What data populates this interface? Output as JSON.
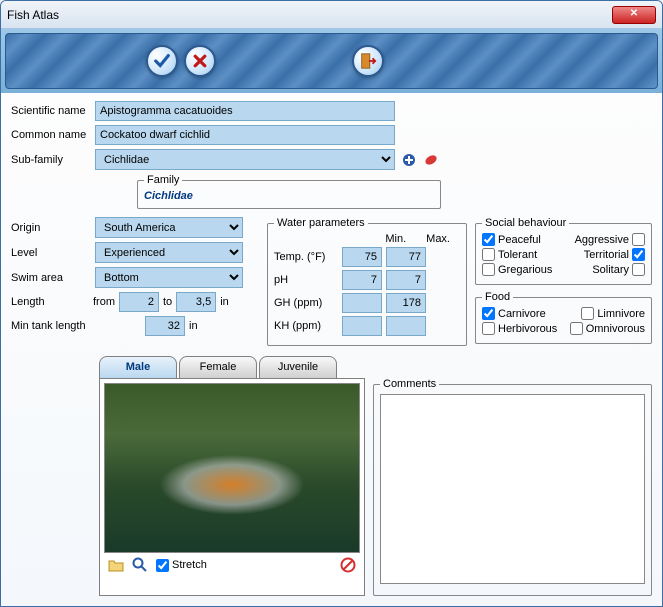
{
  "window": {
    "title": "Fish Atlas"
  },
  "labels": {
    "scientific_name": "Scientific name",
    "common_name": "Common name",
    "sub_family": "Sub-family",
    "family": "Family",
    "origin": "Origin",
    "level": "Level",
    "swim_area": "Swim area",
    "length": "Length",
    "from": "from",
    "to": "to",
    "in": "in",
    "min_tank": "Min tank length",
    "water_params": "Water parameters",
    "min": "Min.",
    "max": "Max.",
    "temp": "Temp. (°F)",
    "ph": "pH",
    "gh": "GH (ppm)",
    "kh": "KH (ppm)",
    "social": "Social behaviour",
    "peaceful": "Peaceful",
    "aggressive": "Aggressive",
    "tolerant": "Tolerant",
    "territorial": "Territorial",
    "gregarious": "Gregarious",
    "solitary": "Solitary",
    "food": "Food",
    "carnivore": "Carnivore",
    "limnivore": "Limnivore",
    "herbivorous": "Herbivorous",
    "omnivorous": "Omnivorous",
    "comments": "Comments",
    "stretch": "Stretch"
  },
  "fields": {
    "scientific_name": "Apistogramma cacatuoides",
    "common_name": "Cockatoo dwarf cichlid",
    "sub_family": "Cichlidae",
    "family_value": "Cichlidae",
    "origin": "South America",
    "level": "Experienced",
    "swim_area": "Bottom",
    "length_from": "2",
    "length_to": "3,5",
    "min_tank": "32",
    "temp_min": "75",
    "temp_max": "77",
    "ph_min": "7",
    "ph_max": "7",
    "gh_min": "",
    "gh_max": "178",
    "kh_min": "",
    "kh_max": ""
  },
  "social": {
    "peaceful": true,
    "aggressive": false,
    "tolerant": false,
    "territorial": true,
    "gregarious": false,
    "solitary": false
  },
  "food": {
    "carnivore": true,
    "limnivore": false,
    "herbivorous": false,
    "omnivorous": false
  },
  "tabs": {
    "male": "Male",
    "female": "Female",
    "juvenile": "Juvenile",
    "active": "male"
  },
  "image_tools": {
    "stretch_checked": true
  },
  "comments": ""
}
